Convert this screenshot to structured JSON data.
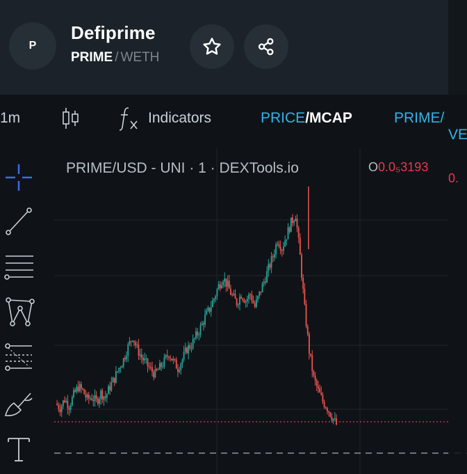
{
  "header": {
    "avatar_letter": "P",
    "token_name": "Defiprime",
    "base_symbol": "PRIME",
    "separator": "/",
    "quote_symbol": "WETH",
    "favorite_icon": "star-icon",
    "share_icon": "share-icon"
  },
  "toolbar": {
    "interval": "1m",
    "candle_icon": "candlestick-icon",
    "indicators_icon": "fx-icon",
    "indicators_label": "Indicators",
    "price_label": "PRICE",
    "slash": "/",
    "mcap_label": "MCAP",
    "pair_label": "PRIME/",
    "pair_cut": "VET"
  },
  "chart": {
    "title": "PRIME/USD - UNI · 1 · DEXTools.io",
    "ohlc_label": "O",
    "ohlc_value": "0.0₅3193",
    "right_clip": "0."
  },
  "tools": [
    {
      "name": "crosshair-icon"
    },
    {
      "name": "trend-line-icon"
    },
    {
      "name": "horizontal-lines-icon"
    },
    {
      "name": "pattern-icon"
    },
    {
      "name": "fib-icon"
    },
    {
      "name": "brush-icon"
    },
    {
      "name": "text-icon"
    }
  ],
  "chart_data": {
    "type": "candlestick",
    "series_color_up": "#26a69a",
    "series_color_down": "#ef5350",
    "close_path": [
      [
        0,
        0.1
      ],
      [
        3,
        0.08
      ],
      [
        6,
        0.12
      ],
      [
        9,
        0.09
      ],
      [
        12,
        0.14
      ],
      [
        15,
        0.18
      ],
      [
        18,
        0.16
      ],
      [
        21,
        0.12
      ],
      [
        24,
        0.13
      ],
      [
        27,
        0.11
      ],
      [
        30,
        0.15
      ],
      [
        33,
        0.13
      ],
      [
        36,
        0.18
      ],
      [
        39,
        0.22
      ],
      [
        42,
        0.27
      ],
      [
        45,
        0.31
      ],
      [
        48,
        0.37
      ],
      [
        51,
        0.42
      ],
      [
        54,
        0.36
      ],
      [
        57,
        0.32
      ],
      [
        60,
        0.29
      ],
      [
        63,
        0.26
      ],
      [
        66,
        0.24
      ],
      [
        69,
        0.27
      ],
      [
        72,
        0.3
      ],
      [
        75,
        0.34
      ],
      [
        78,
        0.3
      ],
      [
        81,
        0.27
      ],
      [
        84,
        0.31
      ],
      [
        87,
        0.36
      ],
      [
        90,
        0.38
      ],
      [
        93,
        0.42
      ],
      [
        96,
        0.46
      ],
      [
        99,
        0.51
      ],
      [
        102,
        0.55
      ],
      [
        105,
        0.6
      ],
      [
        108,
        0.66
      ],
      [
        111,
        0.7
      ],
      [
        114,
        0.66
      ],
      [
        117,
        0.61
      ],
      [
        120,
        0.58
      ],
      [
        123,
        0.62
      ],
      [
        126,
        0.59
      ],
      [
        129,
        0.62
      ],
      [
        132,
        0.56
      ],
      [
        135,
        0.62
      ],
      [
        138,
        0.68
      ],
      [
        141,
        0.74
      ],
      [
        144,
        0.8
      ],
      [
        147,
        0.88
      ],
      [
        150,
        0.84
      ],
      [
        153,
        0.9
      ],
      [
        156,
        0.96
      ],
      [
        159,
        1.0
      ],
      [
        162,
        0.8
      ],
      [
        165,
        0.55
      ],
      [
        168,
        0.35
      ],
      [
        171,
        0.22
      ],
      [
        174,
        0.16
      ],
      [
        177,
        0.11
      ],
      [
        180,
        0.08
      ],
      [
        183,
        0.04
      ],
      [
        186,
        0.0
      ]
    ]
  }
}
